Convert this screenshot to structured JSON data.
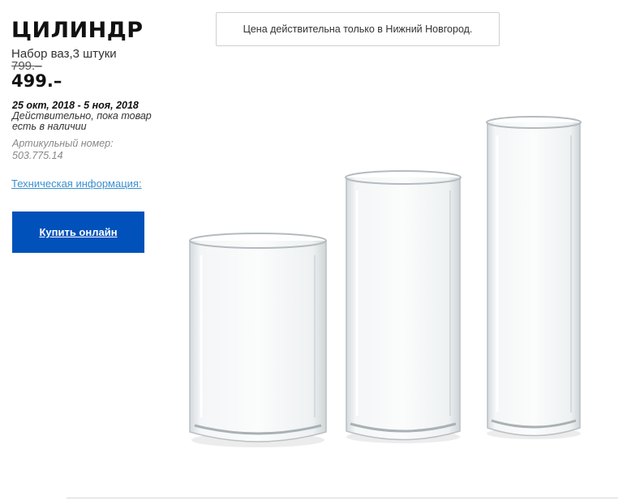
{
  "product": {
    "title": "ЦИЛИНДР",
    "subtitle": "Набор ваз,3 штуки",
    "old_price": "799.–",
    "new_price": "499.–"
  },
  "validity": {
    "dates": "25 окт, 2018 - 5 ноя, 2018",
    "note": "Действительно, пока товар есть в наличии"
  },
  "article": {
    "label": "Артикульный номер:",
    "number": "503.775.14"
  },
  "tech_info_link": "Техническая информация:",
  "buy_button_label": "Купить онлайн",
  "notice_text": "Цена действительна только в Нижний Новгород.",
  "image": {
    "subject": "glass-vases",
    "count": 3
  },
  "colors": {
    "button": "#0051ba",
    "link": "#3a8fd0"
  }
}
